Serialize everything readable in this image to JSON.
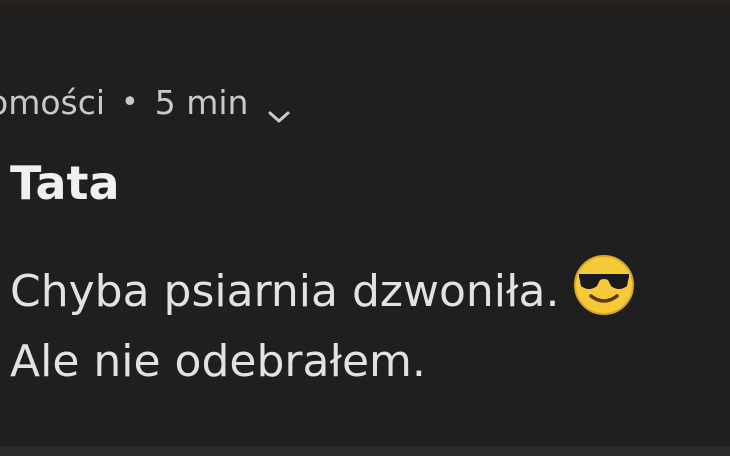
{
  "notification": {
    "app_name": "omości",
    "separator": "•",
    "time": "5 min",
    "expand_icon": "chevron-down-icon",
    "title": "Tata",
    "message_line1": "Chyba psiarnia dzwoniła.",
    "message_line2": "Ale nie odebrałem.",
    "emoji": "sunglasses-face-emoji"
  },
  "colors": {
    "background": "#1f1f1f",
    "header_text": "#c9c9c9",
    "title_text": "#f0f0f0",
    "body_text": "#e2e2e2",
    "emoji_face": "#f5c93a"
  }
}
